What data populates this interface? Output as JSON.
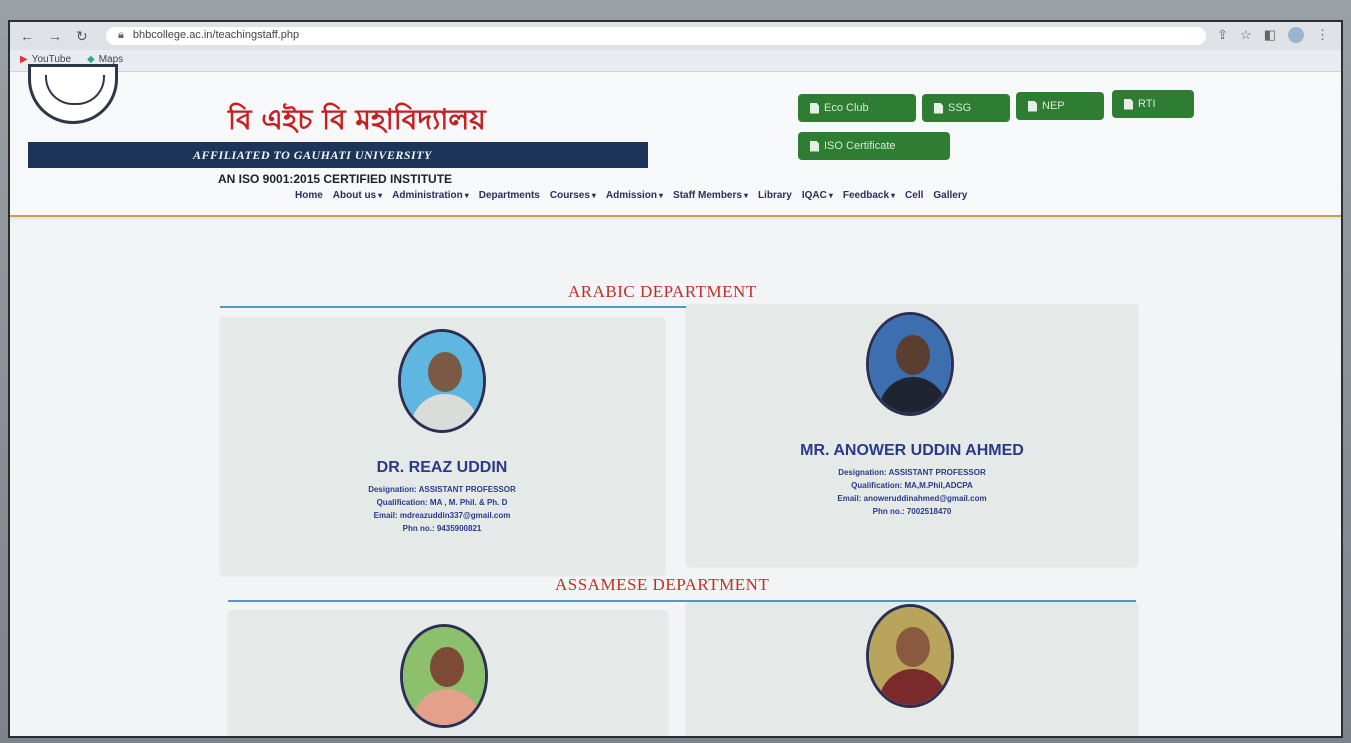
{
  "browser": {
    "url": "bhbcollege.ac.in/teachingstaff.php",
    "bookmarks": [
      "YouTube",
      "Maps"
    ]
  },
  "header": {
    "college_name": "বি এইচ বি মহাবিদ্যালয়",
    "affiliation": "AFFILIATED TO GAUHATI UNIVERSITY",
    "iso": "AN ISO 9001:2015 CERTIFIED INSTITUTE",
    "buttons": {
      "eco": "Eco Club",
      "ssg": "SSG",
      "nep": "NEP",
      "rti": "RTI",
      "iso_cert": "ISO Certificate"
    }
  },
  "menu": {
    "home": "Home",
    "about": "About us",
    "administration": "Administration",
    "departments": "Departments",
    "courses": "Courses",
    "admission": "Admission",
    "staff": "Staff Members",
    "library": "Library",
    "iqac": "IQAC",
    "feedback": "Feedback",
    "cell": "Cell",
    "gallery": "Gallery"
  },
  "departments": [
    {
      "title": "ARABIC DEPARTMENT",
      "teachers": [
        {
          "name": "DR. REAZ UDDIN",
          "designation": "Designation: ASSISTANT PROFESSOR",
          "qualification": "Qualification: MA , M. Phil. & Ph. D",
          "email": "Email: mdreazuddin337@gmail.com",
          "phone": "Phn no.: 9435900821"
        },
        {
          "name": "MR. ANOWER UDDIN AHMED",
          "designation": "Designation: ASSISTANT PROFESSOR",
          "qualification": "Qualification: MA,M.Phil,ADCPA",
          "email": "Email: anoweruddinahmed@gmail.com",
          "phone": "Phn no.: 7002518470"
        }
      ]
    },
    {
      "title": "ASSAMESE DEPARTMENT",
      "teachers": []
    }
  ]
}
